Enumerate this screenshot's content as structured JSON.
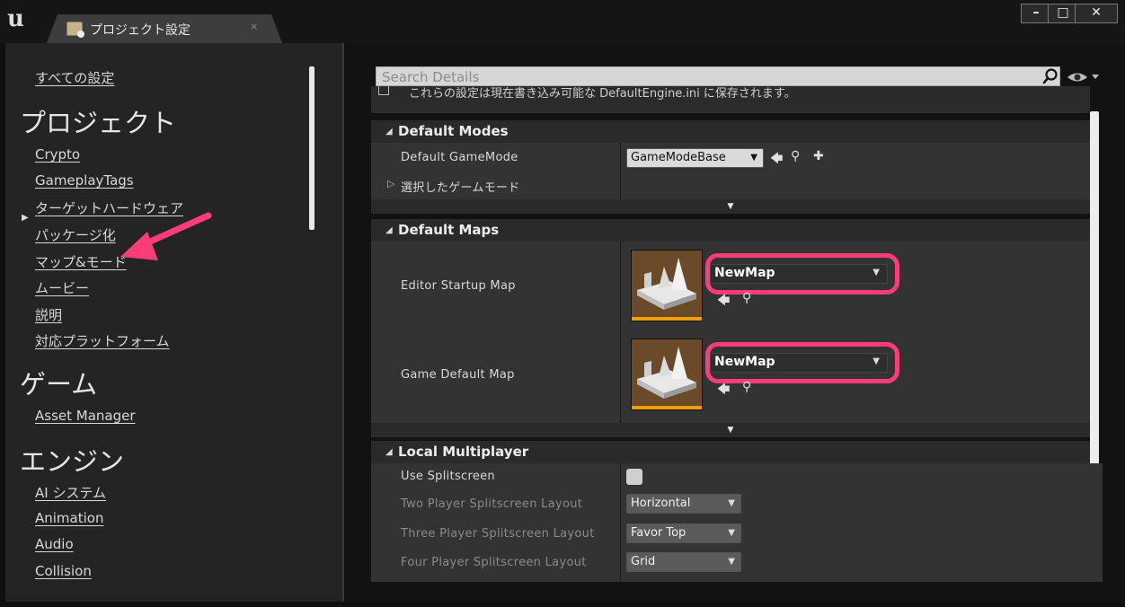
{
  "window": {
    "tab_title": "プロジェクト設定",
    "tab_close": "×",
    "controls": {
      "minimize": "–",
      "maximize": "□",
      "close": "✕"
    },
    "logo": "u"
  },
  "sidebar": {
    "all_settings": "すべての設定",
    "categories": [
      {
        "title": "プロジェクト",
        "items": [
          "Crypto",
          "GameplayTags",
          "ターゲットハードウェア",
          "パッケージ化",
          "マップ&モード",
          "ムービー",
          "説明",
          "対応プラットフォーム"
        ]
      },
      {
        "title": "ゲーム",
        "items": [
          "Asset Manager"
        ]
      },
      {
        "title": "エンジン",
        "items": [
          "AI システム",
          "Animation",
          "Audio",
          "Collision"
        ]
      }
    ],
    "expand_glyph": "▶"
  },
  "details": {
    "search_placeholder": "Search Details",
    "notice": "これらの設定は現在書き込み可能な DefaultEngine.ini に保存されます。",
    "sections": {
      "default_modes": {
        "title": "Default Modes",
        "default_gamemode_label": "Default GameMode",
        "default_gamemode_value": "GameModeBase",
        "selected_gamemode_label": "選択したゲームモード"
      },
      "default_maps": {
        "title": "Default Maps",
        "editor_startup_label": "Editor Startup Map",
        "editor_startup_value": "NewMap",
        "game_default_label": "Game Default Map",
        "game_default_value": "NewMap"
      },
      "local_multiplayer": {
        "title": "Local Multiplayer",
        "use_splitscreen_label": "Use Splitscreen",
        "use_splitscreen_checked": false,
        "two_player_label": "Two Player Splitscreen Layout",
        "two_player_value": "Horizontal",
        "three_player_label": "Three Player Splitscreen Layout",
        "three_player_value": "Favor Top",
        "four_player_label": "Four Player Splitscreen Layout",
        "four_player_value": "Grid"
      }
    },
    "glyphs": {
      "collapse": "◢",
      "caret": "▼",
      "expander": "▼",
      "back": "🡄",
      "browse": "⚲",
      "add": "✚",
      "tree_expand": "▷"
    }
  },
  "colors": {
    "highlight": "#ff3c7a",
    "arrow": "#ff3c7a",
    "thumbnail_bar": "#f0a000"
  }
}
